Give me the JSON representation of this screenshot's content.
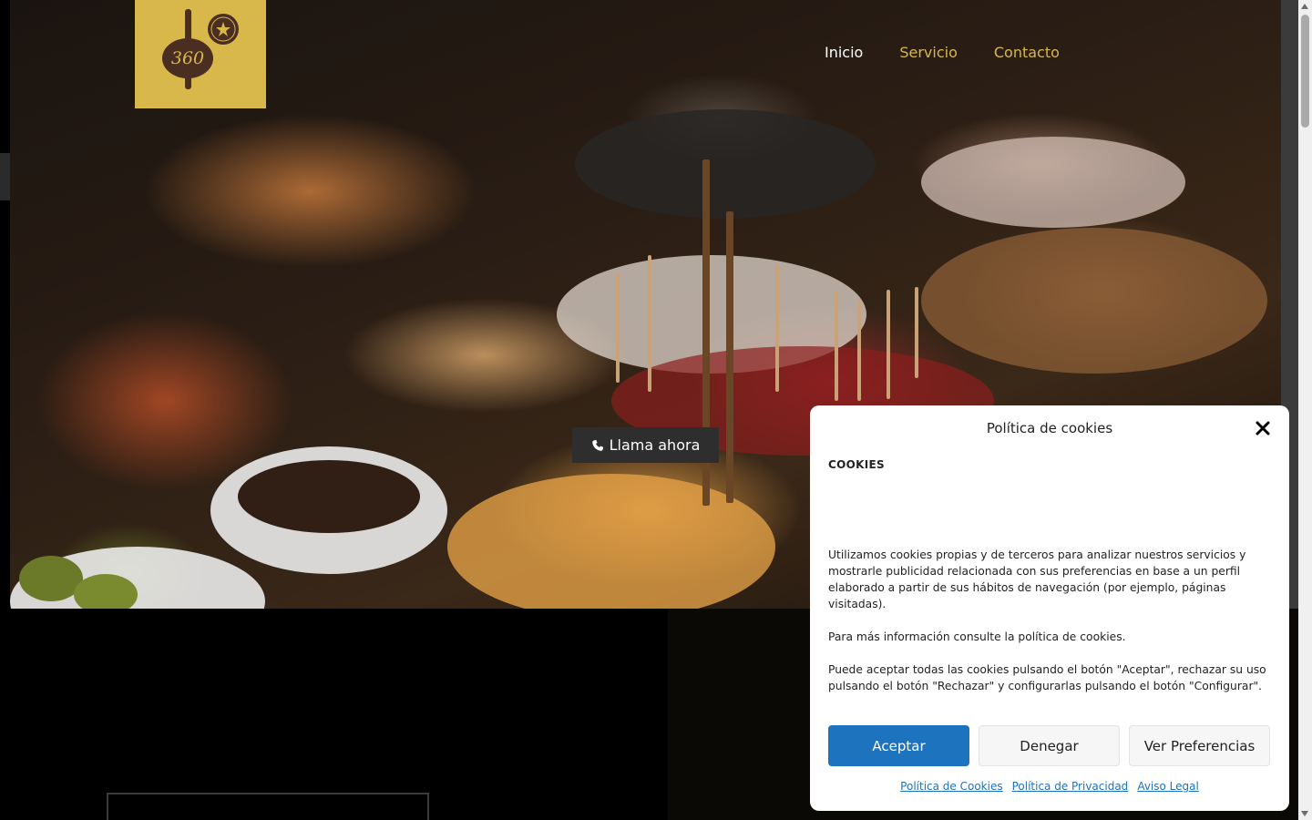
{
  "header": {
    "logo_text": "360",
    "nav": [
      {
        "label": "Inicio",
        "active": true
      },
      {
        "label": "Servicio",
        "active": false
      },
      {
        "label": "Contacto",
        "active": false
      }
    ]
  },
  "hero": {
    "call_button_label": "Llama ahora",
    "call_icon": "phone-icon"
  },
  "cookie_modal": {
    "title": "Política de cookies",
    "heading": "COOKIES",
    "paragraphs": [
      "Utilizamos cookies propias y de terceros para analizar nuestros servicios y mostrarle publicidad relacionada con sus preferencias en base a un perfil elaborado a partir de sus hábitos de navegación (por ejemplo, páginas visitadas).",
      "Para más información consulte la política de cookies.",
      "Puede aceptar todas las cookies pulsando el botón \"Aceptar\", rechazar su uso pulsando el botón \"Rechazar\" y configurarlas pulsando el botón \"Configurar\"."
    ],
    "buttons": {
      "accept": "Aceptar",
      "deny": "Denegar",
      "preferences": "Ver Preferencias"
    },
    "links": {
      "cookies_policy": "Política de Cookies",
      "privacy_policy": "Política de Privacidad",
      "legal_notice": "Aviso Legal"
    }
  },
  "colors": {
    "brand_gold": "#d8b84a",
    "accept_blue": "#1e73be",
    "logo_brown": "#4a2e22"
  }
}
